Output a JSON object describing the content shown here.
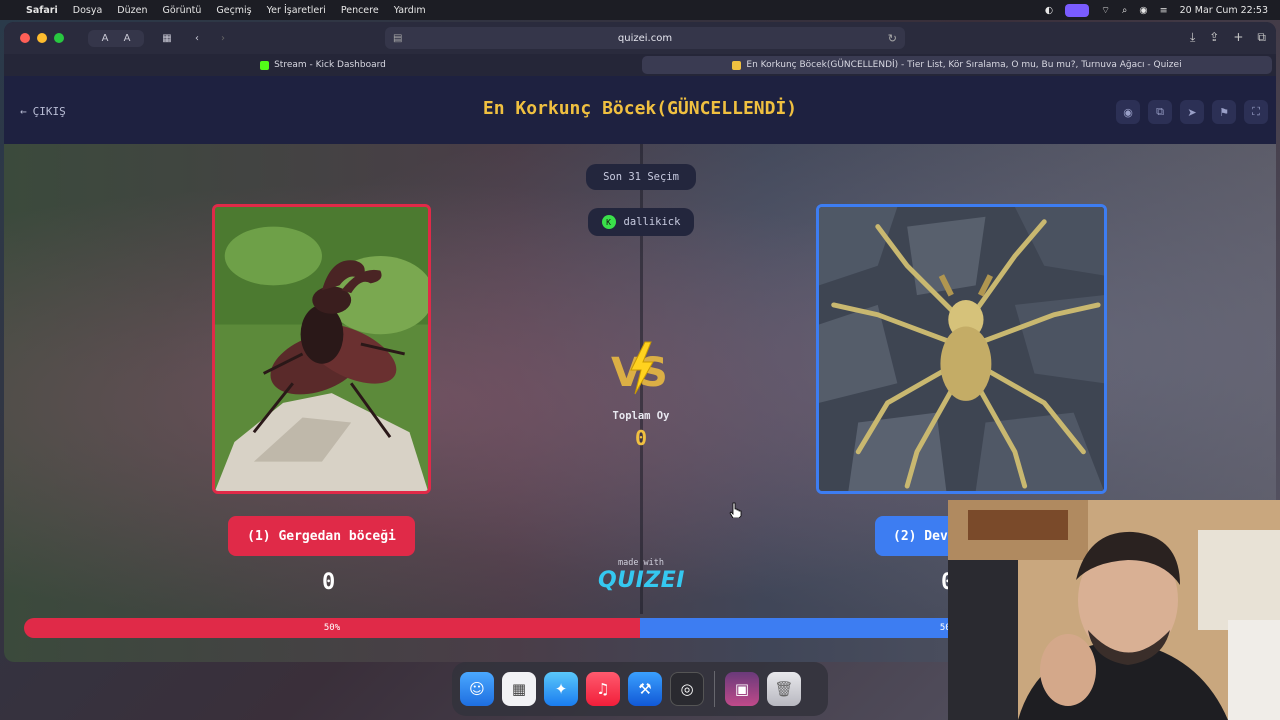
{
  "menubar": {
    "app": "Safari",
    "items": [
      "Dosya",
      "Düzen",
      "Görüntü",
      "Geçmiş",
      "Yer İşaretleri",
      "Pencere",
      "Yardım"
    ],
    "datetime": "20 Mar Cum  22:53"
  },
  "browser": {
    "address": "quizei.com",
    "tabs": [
      {
        "label": "Stream - Kick Dashboard",
        "favicon_color": "#53fc18",
        "active": false
      },
      {
        "label": "En Korkunç Böcek(GÜNCELLENDİ) - Tier List, Kör Sıralama, O mu, Bu mu?, Turnuva Ağacı - Quizei",
        "favicon_color": "#f0c040",
        "active": true
      }
    ]
  },
  "quiz": {
    "exit_label": "ÇIKIŞ",
    "title": "En Korkunç Böcek(GÜNCELLENDİ)",
    "round_label": "Son 31 Seçim",
    "streamer": "dallikick",
    "total_label": "Toplam Oy",
    "total_votes": "0",
    "left": {
      "label": "(1) Gergedan böceği",
      "votes": "0",
      "percent_label": "50%",
      "percent": 50,
      "color": "#e02a48"
    },
    "right": {
      "label": "(2) Dev",
      "votes": "0",
      "percent_label": "50%",
      "percent": 50,
      "color": "#3d7df2"
    },
    "made_with": "made with",
    "brand": "QUIZEI",
    "title_color": "#f0c040"
  },
  "header_icons": [
    "eye-icon",
    "copy-icon",
    "send-icon",
    "flag-icon",
    "fullscreen-icon"
  ],
  "dock": [
    "finder-icon",
    "launchpad-icon",
    "safari-icon",
    "music-icon",
    "xcode-icon",
    "obs-icon",
    "game-icon",
    "trash-icon"
  ]
}
